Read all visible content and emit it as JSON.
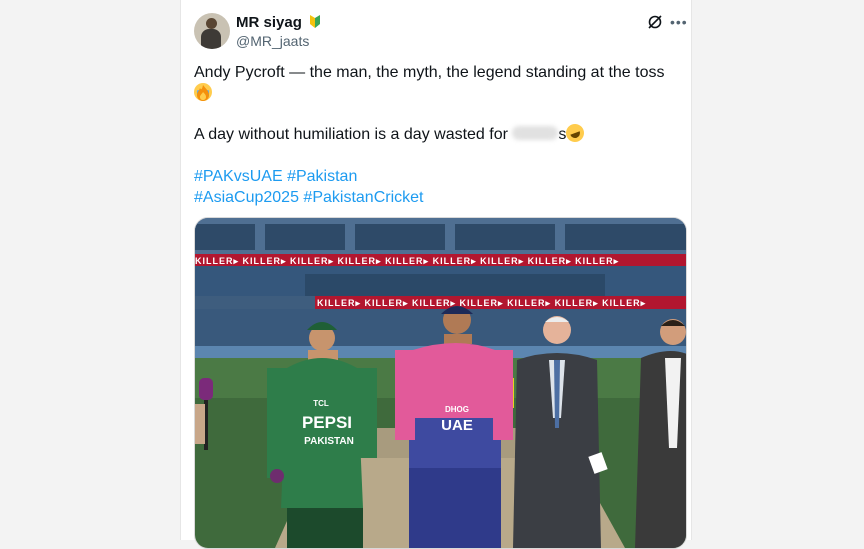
{
  "author": {
    "name": "MR siyag",
    "handle": "@MR_jaats"
  },
  "tweet": {
    "line1": "Andy Pycroft — the man, the myth, the legend standing at the toss",
    "line3_prefix": "A day without humiliation is a day wasted for",
    "line3_suffix": "s",
    "hashtags_line1": [
      "#PAKvsUAE",
      "#Pakistan"
    ],
    "hashtags_line2": [
      "#AsiaCup2025",
      "#PakistanCricket"
    ]
  },
  "media": {
    "boundary_ad": "KILLER",
    "jersey_pak": "PEPSI",
    "jersey_pak_small": "TCL",
    "jersey_pak_country": "PAKISTAN",
    "jersey_uae": "UAE",
    "jersey_uae_sponsor": "DHOG"
  },
  "icons": {
    "badge": "verified-style-leaf-icon",
    "grok": "grok-icon",
    "more": "more-icon"
  },
  "colors": {
    "hashtag": "#1d9bf0",
    "pak_green": "#2e7d4a",
    "uae_pink": "#e25a9a"
  }
}
